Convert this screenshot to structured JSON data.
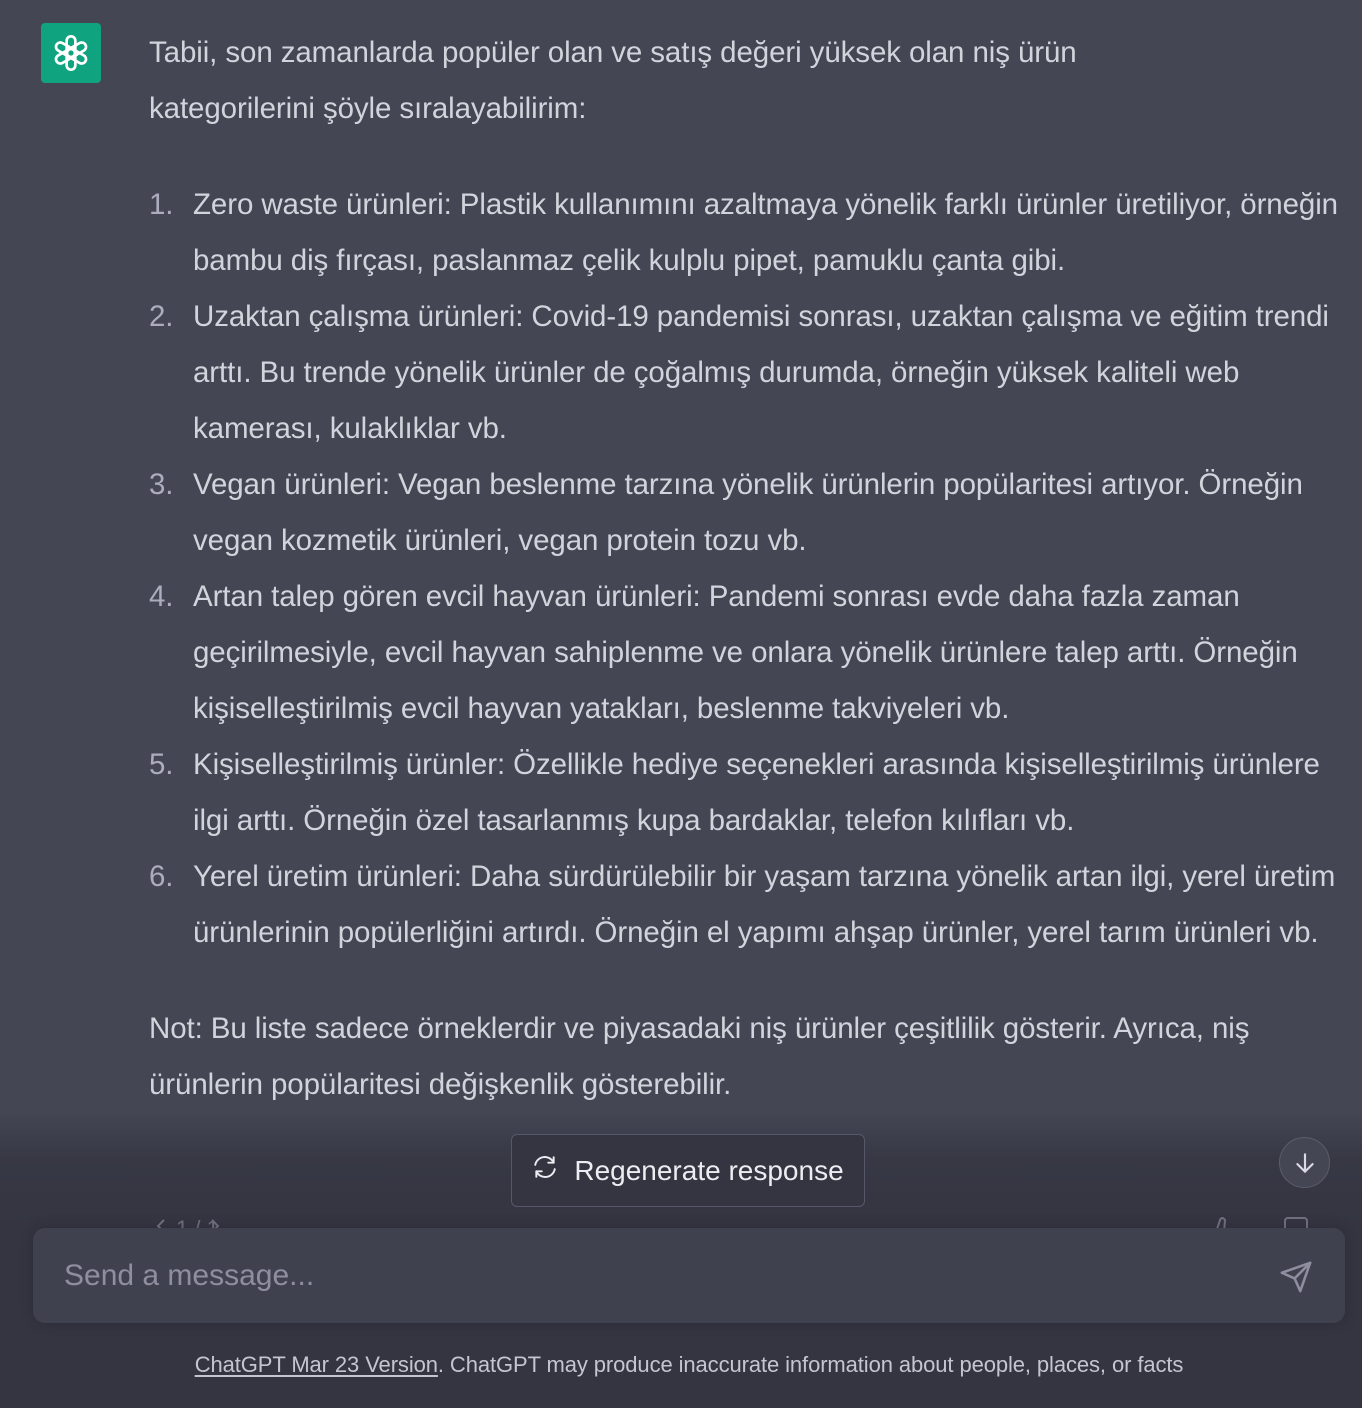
{
  "message": {
    "avatar_icon": "openai-logo-icon",
    "avatar_color": "#10a37f",
    "intro": "Tabii, son zamanlarda popüler olan ve satış değeri yüksek olan niş ürün kategorilerini şöyle sıralayabilirim:",
    "items": [
      {
        "number": "1.",
        "text": "Zero waste ürünleri: Plastik kullanımını azaltmaya yönelik farklı ürünler üretiliyor, örneğin bambu diş fırçası, paslanmaz çelik kulplu pipet, pamuklu çanta gibi."
      },
      {
        "number": "2.",
        "text": "Uzaktan çalışma ürünleri: Covid-19 pandemisi sonrası, uzaktan çalışma ve eğitim trendi arttı. Bu trende yönelik ürünler de çoğalmış durumda, örneğin yüksek kaliteli web kamerası, kulaklıklar vb."
      },
      {
        "number": "3.",
        "text": "Vegan ürünleri: Vegan beslenme tarzına yönelik ürünlerin popülaritesi artıyor. Örneğin vegan kozmetik ürünleri, vegan protein tozu vb."
      },
      {
        "number": "4.",
        "text": "Artan talep gören evcil hayvan ürünleri: Pandemi sonrası evde daha fazla zaman geçirilmesiyle, evcil hayvan sahiplenme ve onlara yönelik ürünlere talep arttı. Örneğin kişiselleştirilmiş evcil hayvan yatakları, beslenme takviyeleri vb."
      },
      {
        "number": "5.",
        "text": "Kişiselleştirilmiş ürünler: Özellikle hediye seçenekleri arasında kişiselleştirilmiş ürünlere ilgi arttı. Örneğin özel tasarlanmış kupa bardaklar, telefon kılıfları vb."
      },
      {
        "number": "6.",
        "text": "Yerel üretim ürünleri: Daha sürdürülebilir bir yaşam tarzına yönelik artan ilgi, yerel üretim ürünlerinin popülerliğini artırdı. Örneğin el yapımı ahşap ürünler, yerel tarım ürünleri vb."
      }
    ],
    "note": "Not: Bu liste sadece örneklerdir ve piyasadaki niş ürünler çeşitlilik gösterir. Ayrıca, niş ürünlerin popülaritesi değişkenlik gösterebilir."
  },
  "regenerate": {
    "label": "Regenerate response",
    "icon": "refresh-icon"
  },
  "scroll_down": {
    "icon": "arrow-down-icon"
  },
  "composer": {
    "placeholder": "Send a message...",
    "value": "",
    "send_icon": "send-icon"
  },
  "footer": {
    "link_text": "ChatGPT Mar 23 Version",
    "text": ". ChatGPT may produce inaccurate information about people, places, or facts"
  },
  "colors": {
    "background": "#343541",
    "message_background": "#444654",
    "text": "#d1d5db",
    "accent": "#10a37f"
  }
}
